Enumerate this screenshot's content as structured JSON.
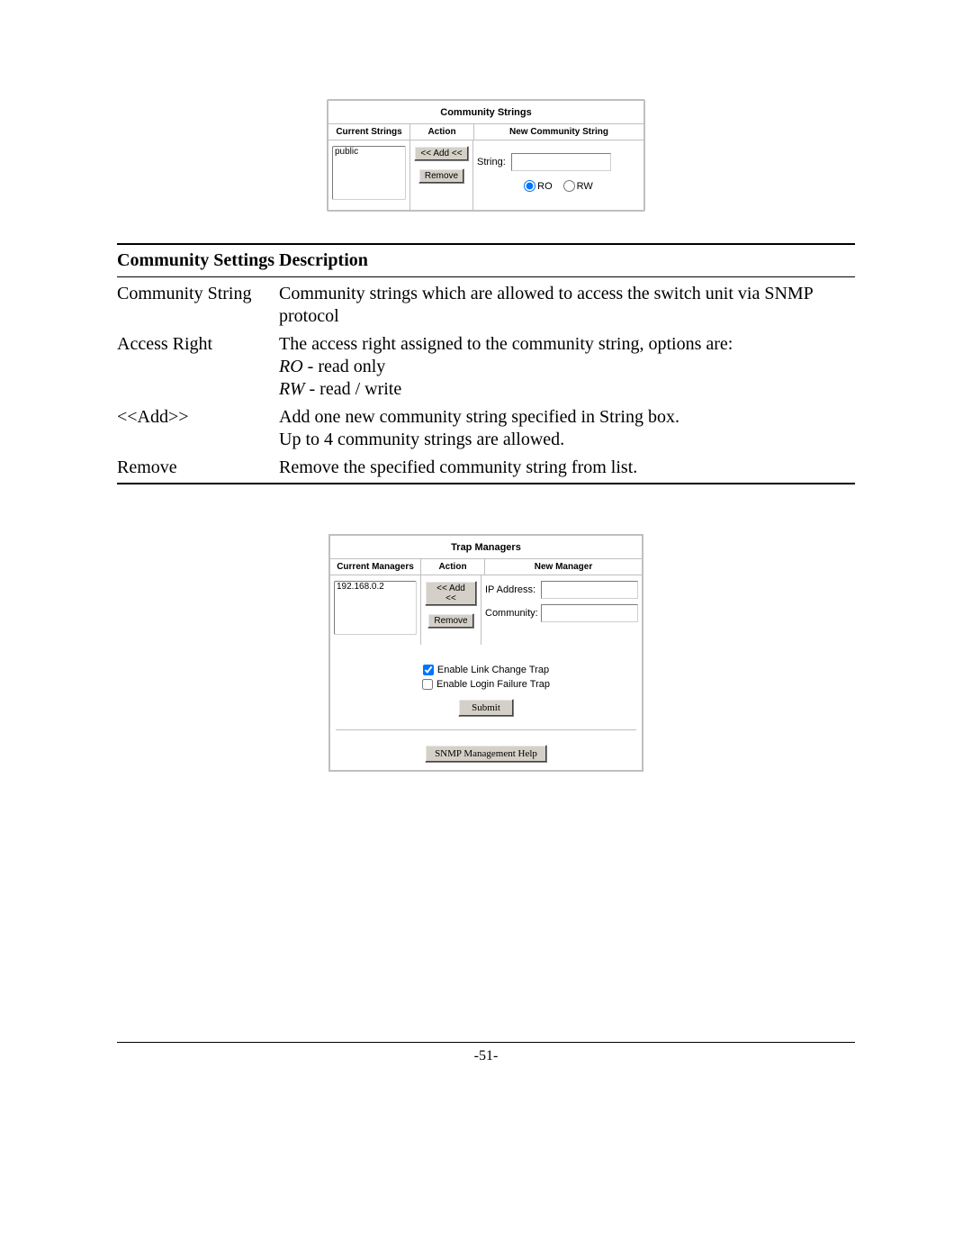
{
  "community_strings_panel": {
    "title": "Community Strings",
    "headers": {
      "current": "Current Strings",
      "action": "Action",
      "new": "New Community String"
    },
    "current_items": [
      "public"
    ],
    "add_button": "<< Add <<",
    "remove_button": "Remove",
    "string_label": "String:",
    "string_value": "",
    "radio_ro": "RO",
    "radio_rw": "RW",
    "radio_selected": "RO"
  },
  "desc_table": {
    "head_setting": "Community Settings",
    "head_desc": "Description",
    "rows": {
      "community_string": {
        "label": "Community String",
        "desc": "Community strings which are allowed to access the switch unit via SNMP protocol"
      },
      "access_right": {
        "label": "Access Right",
        "desc_line1": "The access right assigned to the community string, options are:",
        "ro_tag": "RO",
        "ro_rest": " - read only",
        "rw_tag": "RW",
        "rw_rest": " - read / write"
      },
      "add": {
        "label": "<<Add>>",
        "desc_line1": "Add one new community string specified in String box.",
        "desc_line2": "Up to 4 community strings are allowed."
      },
      "remove": {
        "label": "Remove",
        "desc": "Remove the specified community string from list."
      }
    }
  },
  "trap_panel": {
    "title": "Trap Managers",
    "headers": {
      "current": "Current Managers",
      "action": "Action",
      "new": "New Manager"
    },
    "current_items": [
      "192.168.0.2"
    ],
    "add_button": "<< Add <<",
    "remove_button": "Remove",
    "ip_label": "IP Address:",
    "ip_value": "",
    "community_label": "Community:",
    "community_value": "",
    "enable_link_label": "Enable Link Change Trap",
    "enable_link_checked": true,
    "enable_login_label": "Enable Login Failure Trap",
    "enable_login_checked": false,
    "submit_button": "Submit",
    "help_button": "SNMP Management Help"
  },
  "page_number": "-51-"
}
